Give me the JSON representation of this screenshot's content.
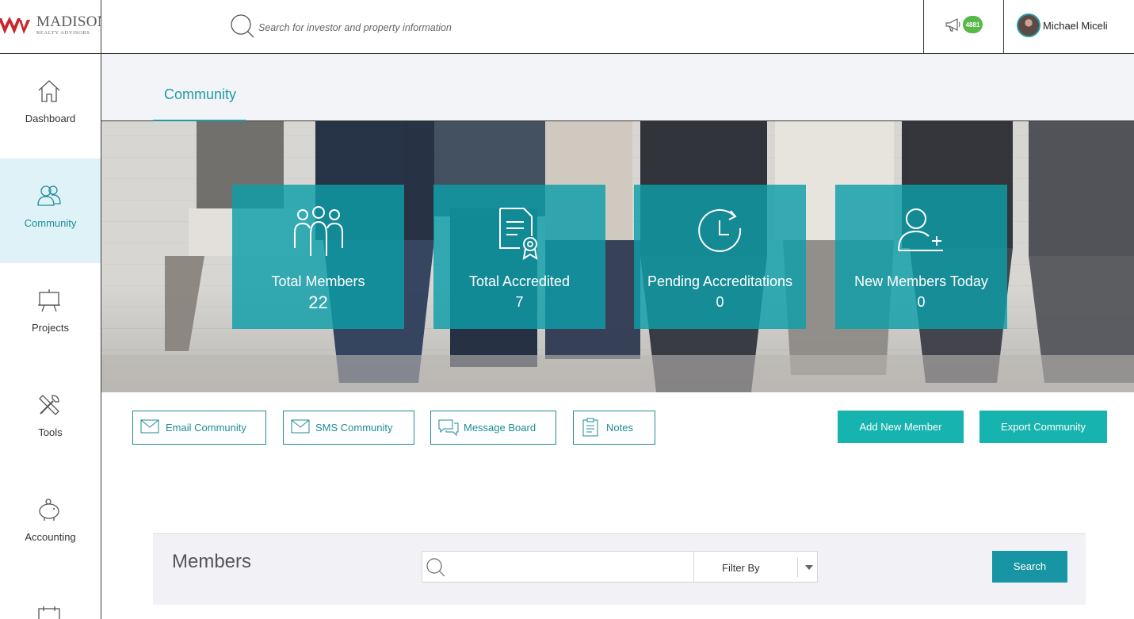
{
  "brand": {
    "name": "MADISON",
    "tagline": "REALTY ADVISORS",
    "colors": {
      "teal": "#1f9ca5",
      "button_teal": "#17b3ae",
      "badge_green": "#58b84a"
    }
  },
  "topbar": {
    "search_placeholder": "Search for investor and property information",
    "search_icon": "search-icon",
    "notification_icon": "megaphone-icon",
    "notification_count": "4881",
    "user_name": "Michael Miceli"
  },
  "sidebar": {
    "items": [
      {
        "label": "Dashboard",
        "icon": "house-icon"
      },
      {
        "label": "Community",
        "icon": "users-icon",
        "active": true
      },
      {
        "label": "Projects",
        "icon": "easel-icon"
      },
      {
        "label": "Tools",
        "icon": "tools-icon"
      },
      {
        "label": "Accounting",
        "icon": "piggy-bank-icon"
      }
    ]
  },
  "page": {
    "active_tab": "Community"
  },
  "stats": [
    {
      "label": "Total Members",
      "value": "22",
      "icon": "members-group-icon"
    },
    {
      "label": "Total Accredited",
      "value": "7",
      "icon": "certificate-icon"
    },
    {
      "label": "Pending Accreditations",
      "value": "0",
      "icon": "clock-icon"
    },
    {
      "label": "New Members Today",
      "value": "0",
      "icon": "user-plus-icon"
    }
  ],
  "actions": {
    "email": "Email Community",
    "sms": "SMS Community",
    "message_board": "Message Board",
    "notes": "Notes",
    "add_member": "Add New Member",
    "export": "Export Community"
  },
  "members": {
    "title": "Members",
    "search_placeholder": "",
    "filter_label": "Filter By",
    "search_button": "Search"
  }
}
